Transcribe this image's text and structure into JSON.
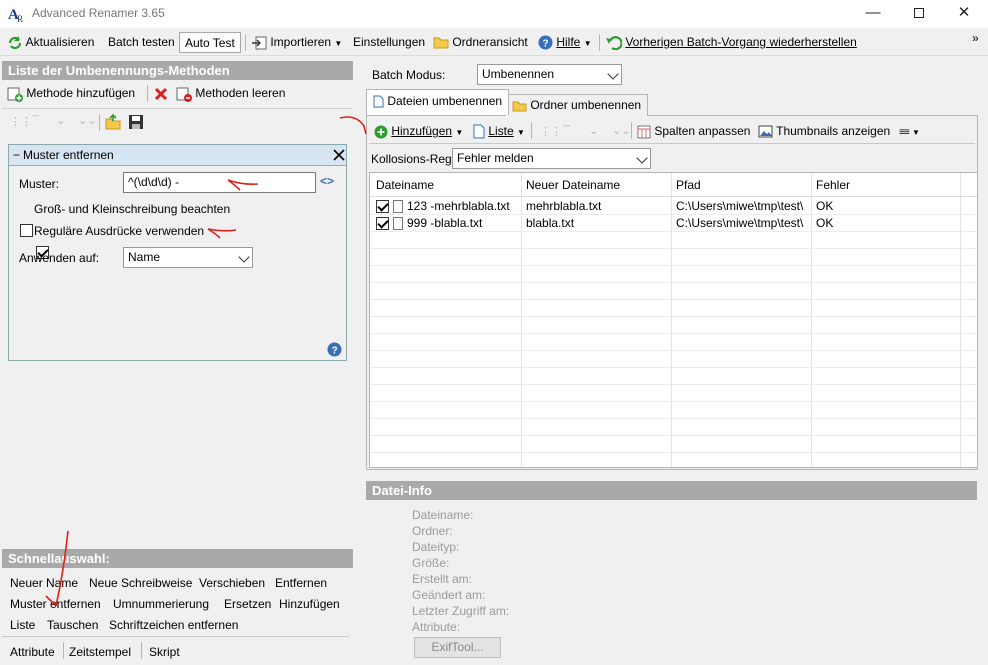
{
  "window": {
    "title": "Advanced Renamer 3.65"
  },
  "toolbar": {
    "refresh": "Aktualisieren",
    "batch_test": "Batch testen",
    "auto_test": "Auto Test",
    "import": "Importieren",
    "settings": "Einstellungen",
    "folder_view": "Ordneransicht",
    "help": "Hilfe",
    "restore": "Vorherigen Batch-Vorgang wiederherstellen",
    "overflow": "»"
  },
  "left": {
    "methods_title": "Liste der Umbenennungs-Methoden",
    "add_method": "Methode hinzufügen",
    "clear_methods": "Methoden leeren",
    "method": {
      "title": "Muster entfernen",
      "pattern_label": "Muster:",
      "pattern_value": "^(\\d\\d\\d) -",
      "case_label": "Groß- und Kleinschreibung beachten",
      "regex_label": "Reguläre Ausdrücke verwenden",
      "apply_label": "Anwenden auf:",
      "apply_value": "Name"
    },
    "quick_title": "Schnellauswahl:",
    "quick_items": [
      "Neuer Name",
      "Neue Schreibweise",
      "Verschieben",
      "Entfernen",
      "Muster entfernen",
      "Umnummerierung",
      "Ersetzen",
      "Hinzufügen",
      "Liste",
      "Tauschen",
      "Schriftzeichen entfernen",
      "Attribute",
      "Zeitstempel",
      "Skript"
    ]
  },
  "right": {
    "batch_mode_label": "Batch Modus:",
    "batch_mode_value": "Umbenennen",
    "tabs": [
      "Dateien umbenennen",
      "Ordner umbenennen"
    ],
    "add": "Hinzufügen",
    "list": "Liste",
    "fit_columns": "Spalten anpassen",
    "thumbnails": "Thumbnails anzeigen",
    "collision_label": "Kollosions-Regel:",
    "collision_value": "Fehler melden",
    "columns": [
      "Dateiname",
      "Neuer Dateiname",
      "Pfad",
      "Fehler"
    ],
    "rows": [
      {
        "name": "123 -mehrblabla.txt",
        "new_name": "mehrblabla.txt",
        "path": "C:\\Users\\miwe\\tmp\\test\\",
        "error": "OK"
      },
      {
        "name": "999 -blabla.txt",
        "new_name": "blabla.txt",
        "path": "C:\\Users\\miwe\\tmp\\test\\",
        "error": "OK"
      }
    ],
    "info_title": "Datei-Info",
    "info_labels": [
      "Dateiname:",
      "Ordner:",
      "Dateityp:",
      "Größe:",
      "Erstellt am:",
      "Geändert am:",
      "Letzter Zugriff am:",
      "Attribute:"
    ],
    "exiftool": "ExifTool..."
  },
  "colors": {
    "section_header": "#a9a9a9",
    "annotation": "#e0201a",
    "method_title": "#d7e4f2"
  }
}
